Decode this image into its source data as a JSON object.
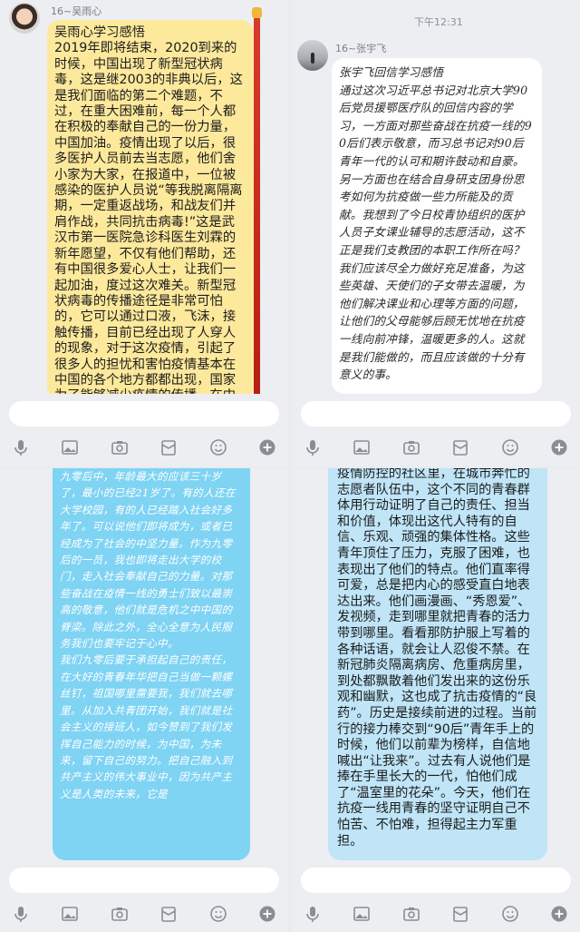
{
  "panel1": {
    "sender": "16~吴雨心",
    "text": "吴雨心学习感悟\n2019年即将结束，2020到来的时候，中国出现了新型冠状病毒，这是继2003的非典以后，这是我们面临的第二个难题，不过，在重大困难前，每一个人都在积极的奉献自己的一份力量，中国加油。疫情出现了以后，很多医护人员前去当志愿，他们舍小家为大家，在报道中，一位被感染的医护人员说“等我脱离隔离期，一定重返战场，和战友们并肩作战，共同抗击病毒!”这是武汉市第一医院急诊科医生刘霖的新年愿望，不仅有他们帮助，还有中国很多爱心人士，让我们一起加油，度过这次难关。新型冠状病毒的传播途径是非常可怕的，它可以通过口液，飞沫，接触传播，目前已经出现了人穿人的现象，对于这次疫情，引起了很多人的担忧和害怕疫情基本在中国的各个地方都都出现，国家为了能够减少疫情的传播，在中"
  },
  "panel2": {
    "time": "下午12:31",
    "sender": "16~张宇飞",
    "text": "张宇飞回信学习感悟\n通过这次习近平总书记对北京大学90后党员援鄂医疗队的回信内容的学习，一方面对那些奋战在抗疫一线的90后们表示敬意，而习总书记对90后青年一代的认可和期许鼓动和自豪。另一方面也在结合自身研支团身份思考如何为抗疫做一些力所能及的贡献。我想到了今日校青协组织的医护人员子女课业辅导的志愿活动，这不正是我们支教团的本职工作所在吗？我们应该尽全力做好充足准备，为这些英雄、天使们的子女带去温暖，为他们解决课业和心理等方面的问题，让他们的父母能够后顾无忧地在抗疫一线向前冲锋，温暖更多的人。这就是我们能做的，而且应该做的十分有意义的事。"
  },
  "panel3": {
    "text": "九零后中，年龄最大的应该三十岁了，最小的已经21岁了。有的人还在大学校园，有的人已经踏入社会好多年了。可以说他们即将成为，或者已经成为了社会的中坚力量。作为九零后的一员，我也即将走出大学的校门，走入社会奉献自己的力量。对那些奋战在疫情一线的勇士们致以最崇高的敬意，他们就是危机之中中国的脊梁。除此之外，全心全意为人民服务我们也要牢记于心中。\n我们九零后要于承担起自己的责任，在大好的青春年华把自己当做一颗螺丝钉，祖国哪里需要我，我们就去哪里。从加入共青团开始，我们就是社会主义的接班人，如今赞到了我们发挥自己能力的时候，为中国，为未来，留下自己的努力。把自己融入到共产主义的伟大事业中，因为共产主义是人类的未来，它是"
  },
  "panel4": {
    "text": "疫情防控的社区里，在城市奔忙的志愿者队伍中，这个不同的青春群体用行动证明了自己的责任、担当和价值，体现出这代人特有的自信、乐观、顽强的集体性格。这些青年顶住了压力，克服了困难，也表现出了他们的特点。他们直率得可爱，总是把内心的感受直白地表达出来。他们画漫画、“秀恩爱”、发视频，走到哪里就把青春的活力带到哪里。看看那防护服上写着的各种话语，就会让人忍俊不禁。在新冠肺炎隔离病房、危重病房里，到处都飘散着他们发出来的这份乐观和幽默，这也成了抗击疫情的“良药”。历史是接续前进的过程。当前行的接力棒交到“90后”青年手上的时候，他们以前辈为榜样，自信地喊出“让我来”。过去有人说他们是捧在手里长大的一代，怕他们成了“温室里的花朵”。今天，他们在抗疫一线用青春的坚守证明自己不怕苦、不怕难，担得起主力军重担。"
  },
  "toolbar": {
    "icons": [
      "microphone-icon",
      "image-icon",
      "camera-icon",
      "red-packet-icon",
      "emoji-icon",
      "plus-icon"
    ]
  },
  "colors": {
    "yellow_bubble": "#fde99c",
    "cyan_bubble": "#7fd3f3",
    "light_blue_bubble": "#bfe5f7",
    "background": "#eceef2"
  }
}
